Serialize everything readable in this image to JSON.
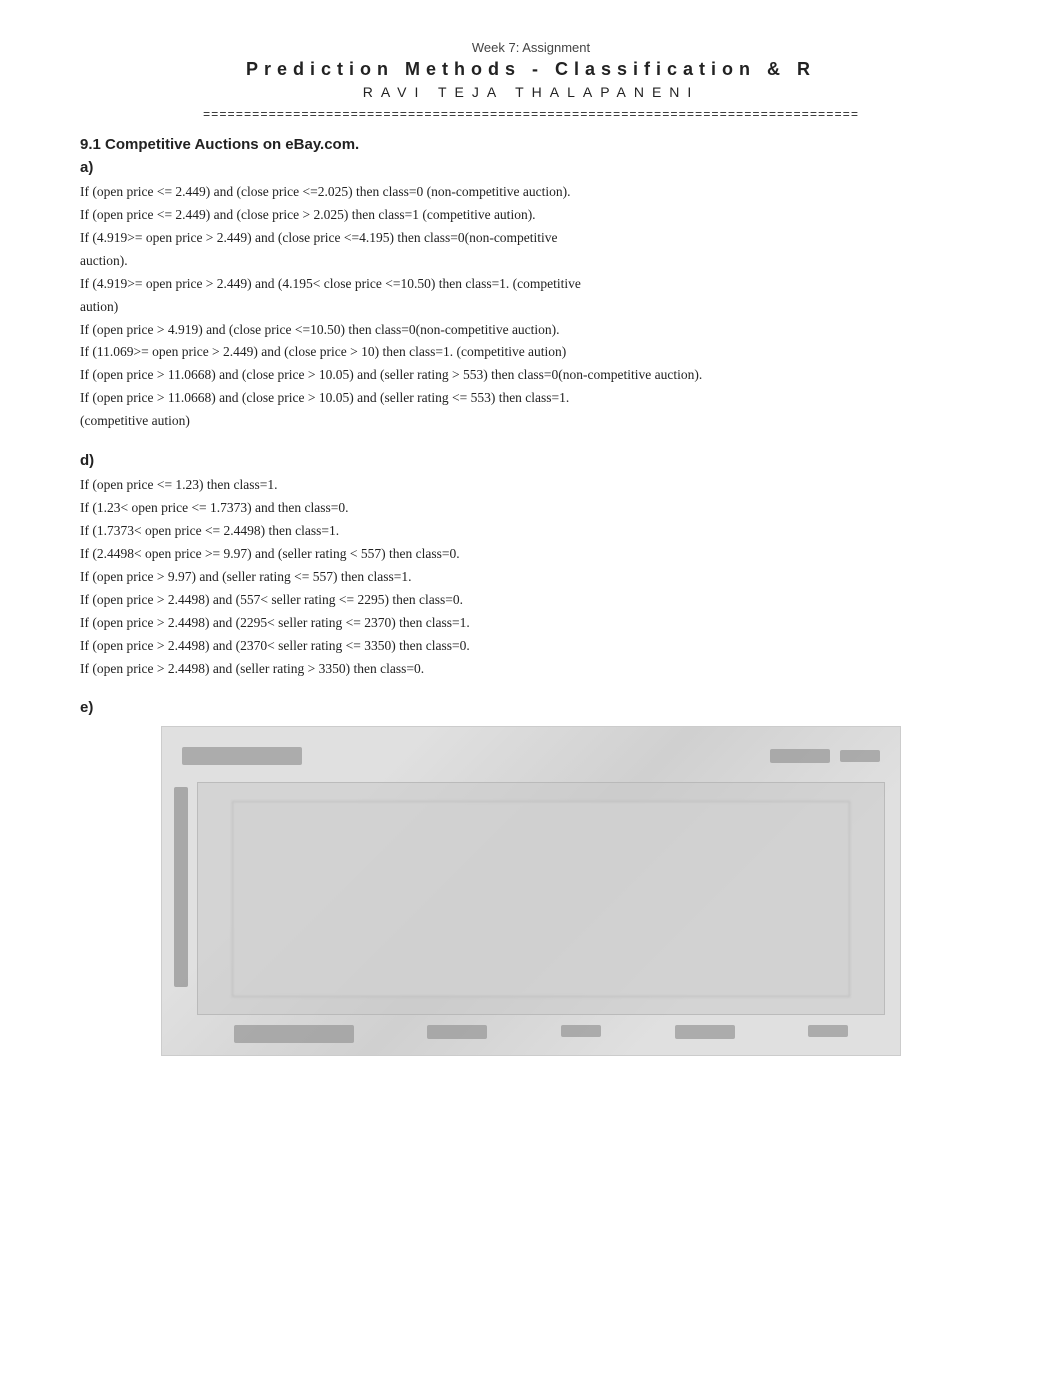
{
  "header": {
    "week_label": "Week 7: Assignment",
    "main_title": "Prediction Methods - Classification & R",
    "author_name": "RAVI   TEJA  THALAPANENI",
    "divider_text": "================================================================================"
  },
  "section_9_1": {
    "title": "9.1 Competitive Auctions on eBay.com.",
    "sub_a_label": "a)",
    "sub_a_rules": [
      " If (open price <= 2.449) and (close price <=2.025) then class=0 (non-competitive auction).",
      "If (open price <= 2.449) and (close price > 2.025) then class=1 (competitive aution).",
      "If (4.919>= open price > 2.449) and (close price <=4.195) then class=0(non-competitive auction).",
      "If (4.919>= open price > 2.449) and (4.195< close price <=10.50) then class=1. (competitive aution)",
      "If (open price > 4.919) and (close price <=10.50) then class=0(non-competitive auction).",
      "If (11.069>= open price > 2.449) and (close price > 10) then class=1. (competitive aution)",
      "If (open price > 11.0668) and (close price > 10.05) and (seller rating > 553) then class=0(non-competitive auction).",
      "If (open price > 11.0668) and (close price > 10.05) and (seller rating <= 553) then class=1. (competitive aution)"
    ],
    "sub_d_label": "d)",
    "sub_d_rules": [
      "If (open price <= 1.23) then class=1.",
      "If (1.23< open price <= 1.7373) and then class=0.",
      "If (1.7373< open price <= 2.4498) then class=1.",
      "If (2.4498< open price >= 9.97) and (seller rating < 557) then class=0.",
      "If (open price > 9.97) and (seller rating <= 557) then class=1.",
      "If (open price > 2.4498) and (557< seller rating <= 2295) then class=0.",
      "If (open price > 2.4498) and (2295< seller rating <= 2370) then class=1.",
      "If (open price > 2.4498) and (2370< seller rating <= 3350) then class=0.",
      "If (open price > 2.4498) and (seller rating > 3350) then class=0."
    ],
    "sub_e_label": "e)"
  }
}
